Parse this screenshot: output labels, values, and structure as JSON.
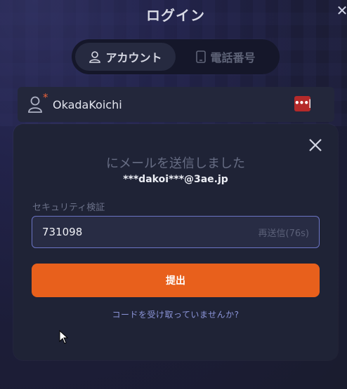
{
  "header": {
    "title": "ログイン",
    "close_icon": "close-icon"
  },
  "tabs": [
    {
      "label": "アカウント",
      "icon": "user-icon",
      "active": true
    },
    {
      "label": "電話番号",
      "icon": "phone-icon",
      "active": false
    }
  ],
  "account": {
    "value": "OkadaKoichi",
    "required_mark": "*",
    "toggle_glyph": "•••|"
  },
  "modal": {
    "message": "にメールを送信しました",
    "masked_email": "***dakoi***@3ae.jp",
    "security_label": "セキュリティ検証",
    "code_value": "731098",
    "resend_label": "再送信(76s)",
    "submit_label": "提出",
    "no_code_link": "コードを受け取っていませんか?"
  },
  "colors": {
    "accent_orange": "#e8601c",
    "link_blue": "#8b94d8",
    "danger_red": "#b52a2a",
    "input_border": "#6b74c4"
  }
}
